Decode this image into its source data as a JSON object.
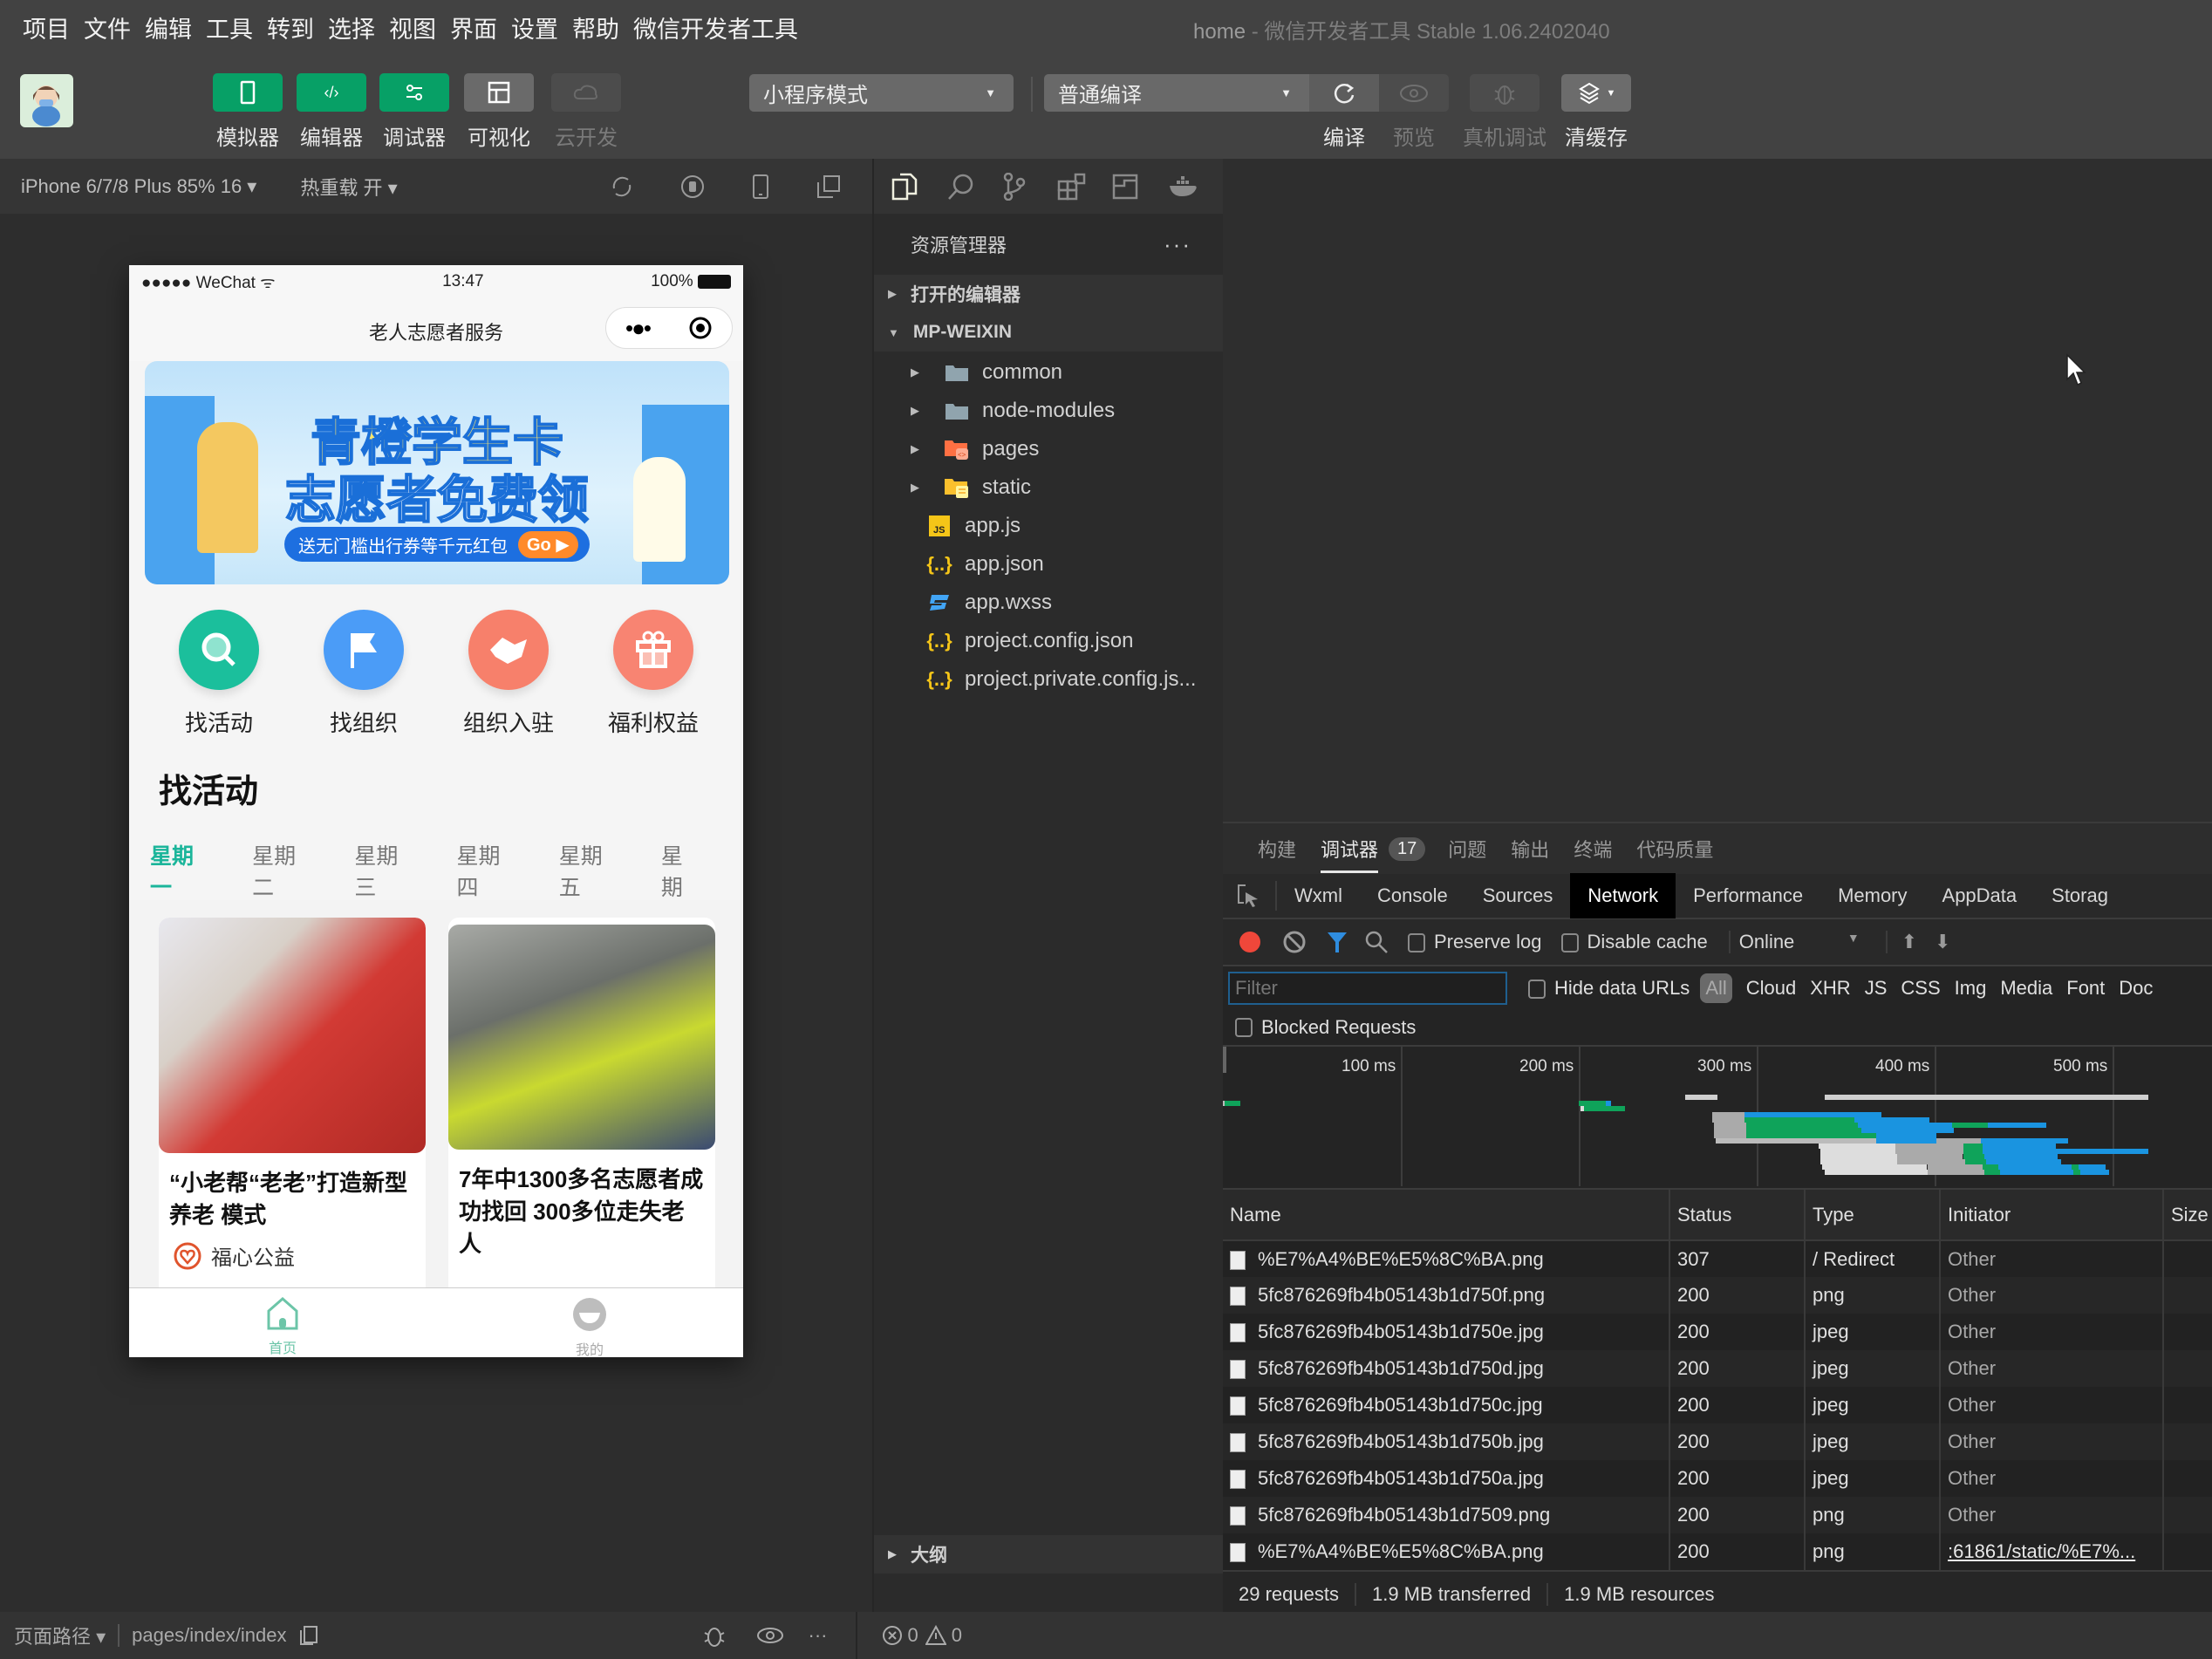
{
  "window": {
    "title_project": "home",
    "title_app": " - 微信开发者工具 Stable 1.06.2402040"
  },
  "menu": [
    "项目",
    "文件",
    "编辑",
    "工具",
    "转到",
    "选择",
    "视图",
    "界面",
    "设置",
    "帮助",
    "微信开发者工具"
  ],
  "toolbar": {
    "avatar": "avatar",
    "modes": [
      {
        "icon": "phone-icon",
        "label": "模拟器",
        "state": "on"
      },
      {
        "icon": "code-icon",
        "label": "编辑器",
        "state": "on"
      },
      {
        "icon": "sliders-icon",
        "label": "调试器",
        "state": "on"
      },
      {
        "icon": "layout-icon",
        "label": "可视化",
        "state": "neutral"
      },
      {
        "icon": "cloud-icon",
        "label": "云开发",
        "state": "disabled"
      }
    ],
    "mode_select": "小程序模式",
    "compile_select": "普通编译",
    "actions": [
      {
        "icon": "refresh-icon",
        "label": "编译",
        "enabled": true
      },
      {
        "icon": "eye-icon",
        "label": "预览",
        "enabled": false
      },
      {
        "icon": "bug-icon",
        "label": "真机调试",
        "enabled": false
      },
      {
        "icon": "layers-icon",
        "label": "清缓存",
        "enabled": true
      }
    ]
  },
  "simulator": {
    "device": "iPhone 6/7/8 Plus 85% 16 ▾",
    "hot_reload": "热重载 开 ▾",
    "phone": {
      "carrier": "●●●●● WeChat",
      "time": "13:47",
      "battery": "100%",
      "page_title": "老人志愿者服务",
      "banner": {
        "line1": "青橙学生卡",
        "line2": "志愿者免费领",
        "sub": "送无门槛出行券等千元红包",
        "cta": "Go"
      },
      "quick_links": [
        {
          "label": "找活动",
          "icon": "search-icon",
          "color": "#1bbf9c"
        },
        {
          "label": "找组织",
          "icon": "flag-icon",
          "color": "#4b9cf7"
        },
        {
          "label": "组织入驻",
          "icon": "handshake-icon",
          "color": "#f7806b"
        },
        {
          "label": "福利权益",
          "icon": "gift-icon",
          "color": "#f88472"
        }
      ],
      "section_title": "找活动",
      "days": [
        "星期一",
        "星期二",
        "星期三",
        "星期四",
        "星期五",
        "星期"
      ],
      "active_day": 0,
      "cards": [
        {
          "title": "“小老帮“老老”打造新型养老 模式",
          "org": "福心公益"
        },
        {
          "title": "7年中1300多名志愿者成功找回 300多位走失老人",
          "org": ""
        }
      ],
      "tabs": [
        {
          "label": "首页",
          "active": true
        },
        {
          "label": "我的",
          "active": false
        }
      ]
    },
    "footer": {
      "path_label": "页面路径 ▾",
      "path": "pages/index/index"
    }
  },
  "explorer": {
    "title": "资源管理器",
    "open_editors": "打开的编辑器",
    "project": "MP-WEIXIN",
    "items": [
      {
        "name": "common",
        "type": "folder"
      },
      {
        "name": "node-modules",
        "type": "folder"
      },
      {
        "name": "pages",
        "type": "folder-pages"
      },
      {
        "name": "static",
        "type": "folder-static"
      },
      {
        "name": "app.js",
        "type": "js"
      },
      {
        "name": "app.json",
        "type": "json"
      },
      {
        "name": "app.wxss",
        "type": "css"
      },
      {
        "name": "project.config.json",
        "type": "json"
      },
      {
        "name": "project.private.config.js...",
        "type": "json"
      }
    ],
    "outline": "大纲",
    "errors": "0",
    "warnings": "0"
  },
  "devtools": {
    "top_tabs": [
      "构建",
      "调试器",
      "问题",
      "输出",
      "终端",
      "代码质量"
    ],
    "active_top_tab": "调试器",
    "badge": "17",
    "panel_tabs": [
      "Wxml",
      "Console",
      "Sources",
      "Network",
      "Performance",
      "Memory",
      "AppData",
      "Storag"
    ],
    "active_panel": "Network",
    "toolbar": {
      "preserve_log": "Preserve log",
      "disable_cache": "Disable cache",
      "throttle": "Online"
    },
    "filter_placeholder": "Filter",
    "hide_data_urls": "Hide data URLs",
    "types": [
      "All",
      "Cloud",
      "XHR",
      "JS",
      "CSS",
      "Img",
      "Media",
      "Font",
      "Doc"
    ],
    "blocked": "Blocked Requests",
    "timeline_ticks": [
      "100 ms",
      "200 ms",
      "300 ms",
      "400 ms",
      "500 ms"
    ],
    "columns": [
      "Name",
      "Status",
      "Type",
      "Initiator",
      "Size"
    ],
    "rows": [
      {
        "name": "%E7%A4%BE%E5%8C%BA.png",
        "status": "307",
        "type": "/ Redirect",
        "initiator": "Other"
      },
      {
        "name": "5fc876269fb4b05143b1d750f.png",
        "status": "200",
        "type": "png",
        "initiator": "Other"
      },
      {
        "name": "5fc876269fb4b05143b1d750e.jpg",
        "status": "200",
        "type": "jpeg",
        "initiator": "Other"
      },
      {
        "name": "5fc876269fb4b05143b1d750d.jpg",
        "status": "200",
        "type": "jpeg",
        "initiator": "Other"
      },
      {
        "name": "5fc876269fb4b05143b1d750c.jpg",
        "status": "200",
        "type": "jpeg",
        "initiator": "Other"
      },
      {
        "name": "5fc876269fb4b05143b1d750b.jpg",
        "status": "200",
        "type": "jpeg",
        "initiator": "Other"
      },
      {
        "name": "5fc876269fb4b05143b1d750a.jpg",
        "status": "200",
        "type": "jpeg",
        "initiator": "Other"
      },
      {
        "name": "5fc876269fb4b05143b1d7509.png",
        "status": "200",
        "type": "png",
        "initiator": "Other"
      },
      {
        "name": "%E7%A4%BE%E5%8C%BA.png",
        "status": "200",
        "type": "png",
        "initiator": ":61861/static/%E7%..."
      }
    ],
    "summary": [
      "29 requests",
      "1.9 MB transferred",
      "1.9 MB resources"
    ]
  },
  "colors": {
    "accent": "#07a066",
    "tab_active": "#1bb59a",
    "record": "#f0473a",
    "link_blue": "#2f8ddf"
  }
}
